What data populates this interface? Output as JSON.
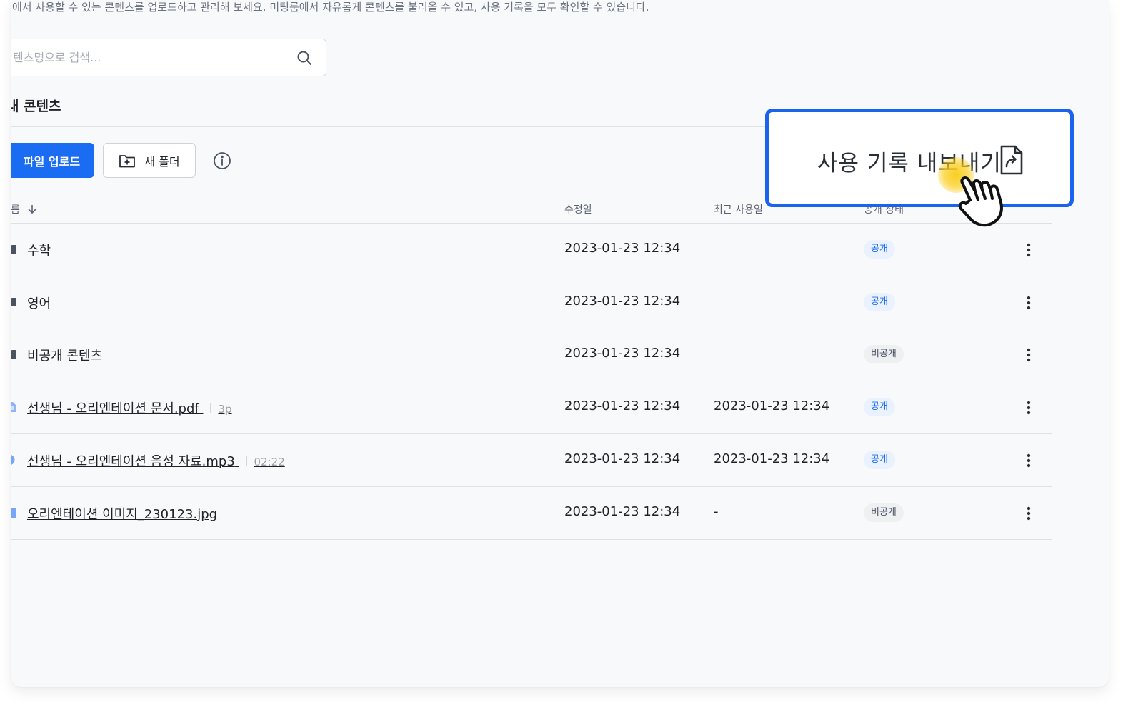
{
  "description": "에서 사용할 수 있는 콘텐츠를 업로드하고 관리해 보세요. 미팅룸에서 자유롭게 콘텐츠를 불러올 수 있고, 사용 기록을 모두 확인할 수 있습니다.",
  "search": {
    "placeholder": "텐츠명으로 검색..."
  },
  "section_title": "내 콘텐츠",
  "toolbar": {
    "upload_label": "파일 업로드",
    "new_folder_label": "새 폴더"
  },
  "export": {
    "label": "사용 기록 내보내기"
  },
  "table": {
    "headers": {
      "name": "름",
      "modified": "수정일",
      "last_used": "최근 사용일",
      "status": "공개 상태"
    },
    "rows": [
      {
        "type": "folder",
        "name": "수학",
        "meta": "",
        "modified": "2023-01-23 12:34",
        "last_used": "",
        "status": "공개",
        "status_kind": "public"
      },
      {
        "type": "folder",
        "name": "영어",
        "meta": "",
        "modified": "2023-01-23 12:34",
        "last_used": "",
        "status": "공개",
        "status_kind": "public"
      },
      {
        "type": "folder",
        "name": "비공개 콘텐츠",
        "meta": "",
        "modified": "2023-01-23 12:34",
        "last_used": "",
        "status": "비공개",
        "status_kind": "private"
      },
      {
        "type": "pdf",
        "name": "선생님 - 오리엔테이션 문서.pdf",
        "meta": "3p",
        "modified": "2023-01-23 12:34",
        "last_used": "2023-01-23 12:34",
        "status": "공개",
        "status_kind": "public"
      },
      {
        "type": "audio",
        "name": "선생님 - 오리엔테이션 음성 자료.mp3",
        "meta": "02:22",
        "modified": "2023-01-23 12:34",
        "last_used": "2023-01-23 12:34",
        "status": "공개",
        "status_kind": "public"
      },
      {
        "type": "image",
        "name": "오리엔테이션 이미지_230123.jpg",
        "meta": "",
        "modified": "2023-01-23 12:34",
        "last_used": "-",
        "status": "비공개",
        "status_kind": "private"
      }
    ]
  },
  "colors": {
    "accent": "#1a6cf3",
    "callout_border": "#1a63ee",
    "public_badge_bg": "#eaf2ff",
    "private_badge_bg": "#eef0f2"
  }
}
